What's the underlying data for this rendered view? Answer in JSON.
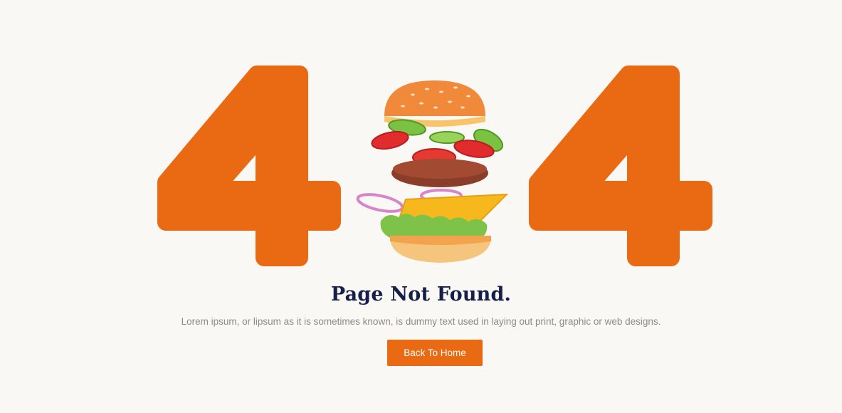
{
  "error": {
    "code_left_digit": "4",
    "code_right_digit": "4",
    "illustration": "burger-ingredients-illustration",
    "title": "Page Not Found.",
    "description": "Lorem ipsum, or lipsum as it is sometimes known, is dummy text used in laying out print, graphic or web designs.",
    "button_label": "Back To Home"
  },
  "colors": {
    "accent": "#e96a13",
    "title": "#14204a",
    "body_text": "#8a8a8a",
    "background": "#faf8f5"
  }
}
